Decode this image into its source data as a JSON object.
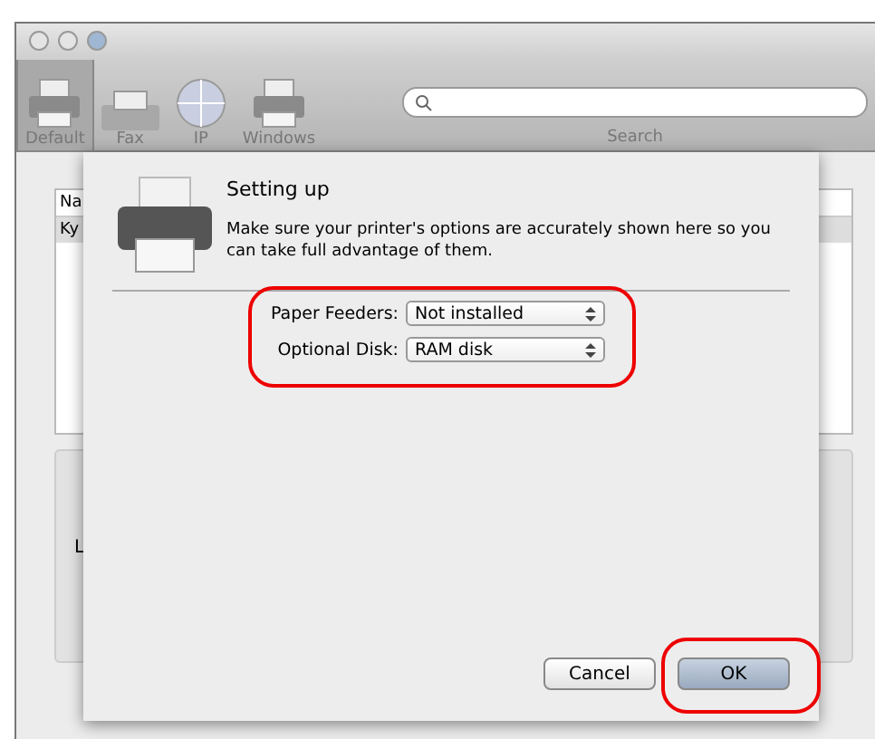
{
  "window": {
    "toolbar": [
      {
        "label": "Default",
        "selected": true
      },
      {
        "label": "Fax",
        "selected": false
      },
      {
        "label": "IP",
        "selected": false
      },
      {
        "label": "Windows",
        "selected": false
      }
    ],
    "search": {
      "label": "Search"
    }
  },
  "printer_list": {
    "header": "Na",
    "rows": [
      "Ky"
    ]
  },
  "info_label": "L",
  "sheet": {
    "title": "Setting up",
    "message": "Make sure your printer's options are accurately shown here so you can take full advantage of them.",
    "options": [
      {
        "label": "Paper Feeders:",
        "value": "Not installed"
      },
      {
        "label": "Optional Disk:",
        "value": "RAM disk"
      }
    ],
    "buttons": [
      {
        "label": "Cancel",
        "default": false
      },
      {
        "label": "OK",
        "default": true
      }
    ]
  }
}
